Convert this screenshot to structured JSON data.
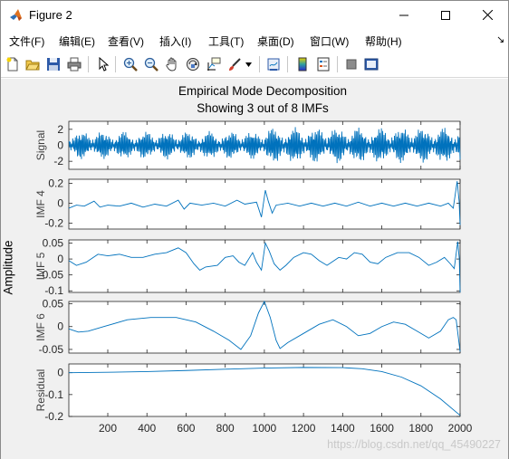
{
  "window": {
    "title": "Figure 2",
    "controls": {
      "minimize": "minimize",
      "maximize": "maximize",
      "close": "close"
    }
  },
  "menubar": {
    "items": [
      "文件(F)",
      "编辑(E)",
      "查看(V)",
      "插入(I)",
      "工具(T)",
      "桌面(D)",
      "窗口(W)",
      "帮助(H)"
    ],
    "corner": "↘"
  },
  "toolbar": {
    "icons": [
      "new-figure-icon",
      "open-file-icon",
      "save-icon",
      "print-icon",
      "pointer-icon",
      "zoom-in-icon",
      "zoom-out-icon",
      "pan-icon",
      "rotate-3d-icon",
      "data-cursor-icon",
      "brush-icon",
      "brush-dropdown-icon",
      "link-plot-icon",
      "insert-colorbar-icon",
      "insert-legend-icon",
      "hide-plot-tools-icon",
      "show-plot-tools-icon"
    ]
  },
  "figure": {
    "title_line1": "Empirical Mode Decomposition",
    "title_line2": "Showing 3 out of 8 IMFs",
    "ylabel": "Amplitude",
    "xticks": [
      "200",
      "400",
      "600",
      "800",
      "1000",
      "1200",
      "1400",
      "1600",
      "1800",
      "2000"
    ],
    "line_color": "#0072bd",
    "watermark": "https://blog.csdn.net/qq_45490227"
  },
  "chart_data": [
    {
      "type": "line",
      "ylabel": "Signal",
      "xlim": [
        1,
        2000
      ],
      "ylim": [
        -3,
        3
      ],
      "yticks": [
        "2",
        "0",
        "-2"
      ],
      "description_points": [
        [
          1,
          0
        ],
        [
          1000,
          0
        ],
        [
          2000,
          0
        ]
      ],
      "amplitude_before_1000": 1.8,
      "amplitude_after_1000": 2.3
    },
    {
      "type": "line",
      "ylabel": "IMF 4",
      "xlim": [
        1,
        2000
      ],
      "ylim": [
        -0.26,
        0.24
      ],
      "yticks": [
        "0.2",
        "0",
        "-0.2"
      ],
      "points": [
        [
          1,
          -0.05
        ],
        [
          40,
          -0.02
        ],
        [
          80,
          -0.03
        ],
        [
          130,
          0.02
        ],
        [
          160,
          -0.04
        ],
        [
          200,
          -0.02
        ],
        [
          260,
          -0.03
        ],
        [
          320,
          0.0
        ],
        [
          380,
          -0.04
        ],
        [
          440,
          -0.01
        ],
        [
          500,
          -0.03
        ],
        [
          560,
          0.03
        ],
        [
          590,
          -0.06
        ],
        [
          620,
          0.0
        ],
        [
          680,
          -0.02
        ],
        [
          740,
          0.0
        ],
        [
          800,
          -0.03
        ],
        [
          860,
          0.03
        ],
        [
          900,
          -0.01
        ],
        [
          960,
          0.01
        ],
        [
          985,
          -0.14
        ],
        [
          1005,
          0.13
        ],
        [
          1020,
          0.02
        ],
        [
          1040,
          -0.1
        ],
        [
          1060,
          -0.02
        ],
        [
          1120,
          0.0
        ],
        [
          1180,
          -0.03
        ],
        [
          1240,
          0.0
        ],
        [
          1300,
          -0.03
        ],
        [
          1360,
          0.0
        ],
        [
          1420,
          -0.03
        ],
        [
          1480,
          0.01
        ],
        [
          1540,
          -0.03
        ],
        [
          1600,
          0.0
        ],
        [
          1660,
          -0.03
        ],
        [
          1720,
          0.0
        ],
        [
          1780,
          -0.03
        ],
        [
          1840,
          0.0
        ],
        [
          1900,
          -0.03
        ],
        [
          1940,
          0.0
        ],
        [
          1965,
          -0.05
        ],
        [
          1985,
          0.22
        ],
        [
          1995,
          0.02
        ],
        [
          2000,
          -0.22
        ]
      ]
    },
    {
      "type": "line",
      "ylabel": "IMF 5",
      "xlim": [
        1,
        2000
      ],
      "ylim": [
        -0.105,
        0.06
      ],
      "yticks": [
        "0.05",
        "0",
        "-0.05",
        "-0.1"
      ],
      "points": [
        [
          1,
          -0.005
        ],
        [
          40,
          -0.02
        ],
        [
          90,
          -0.01
        ],
        [
          150,
          0.015
        ],
        [
          200,
          0.01
        ],
        [
          260,
          0.015
        ],
        [
          320,
          0.005
        ],
        [
          380,
          0.005
        ],
        [
          440,
          0.015
        ],
        [
          500,
          0.02
        ],
        [
          560,
          0.035
        ],
        [
          600,
          0.02
        ],
        [
          640,
          -0.015
        ],
        [
          670,
          -0.035
        ],
        [
          700,
          -0.025
        ],
        [
          760,
          -0.02
        ],
        [
          800,
          0.005
        ],
        [
          840,
          0.01
        ],
        [
          870,
          -0.01
        ],
        [
          900,
          -0.02
        ],
        [
          940,
          0.02
        ],
        [
          960,
          -0.01
        ],
        [
          985,
          -0.035
        ],
        [
          1005,
          0.05
        ],
        [
          1025,
          0.025
        ],
        [
          1050,
          -0.015
        ],
        [
          1080,
          -0.035
        ],
        [
          1110,
          -0.02
        ],
        [
          1150,
          0.005
        ],
        [
          1200,
          0.02
        ],
        [
          1240,
          0.015
        ],
        [
          1280,
          -0.005
        ],
        [
          1320,
          -0.02
        ],
        [
          1380,
          0.005
        ],
        [
          1420,
          0.0
        ],
        [
          1460,
          0.02
        ],
        [
          1500,
          0.015
        ],
        [
          1540,
          -0.01
        ],
        [
          1580,
          -0.015
        ],
        [
          1620,
          0.005
        ],
        [
          1680,
          0.02
        ],
        [
          1740,
          0.02
        ],
        [
          1790,
          0.005
        ],
        [
          1840,
          -0.02
        ],
        [
          1880,
          -0.01
        ],
        [
          1920,
          0.005
        ],
        [
          1950,
          -0.015
        ],
        [
          1970,
          -0.03
        ],
        [
          1988,
          0.055
        ],
        [
          1996,
          0.0
        ],
        [
          2000,
          -0.105
        ]
      ]
    },
    {
      "type": "line",
      "ylabel": "IMF 6",
      "xlim": [
        1,
        2000
      ],
      "ylim": [
        -0.058,
        0.055
      ],
      "yticks": [
        "0.05",
        "0",
        "-0.05"
      ],
      "points": [
        [
          1,
          -0.005
        ],
        [
          50,
          -0.012
        ],
        [
          100,
          -0.01
        ],
        [
          180,
          0.0
        ],
        [
          300,
          0.015
        ],
        [
          420,
          0.02
        ],
        [
          550,
          0.02
        ],
        [
          650,
          0.01
        ],
        [
          740,
          -0.01
        ],
        [
          820,
          -0.03
        ],
        [
          880,
          -0.05
        ],
        [
          930,
          -0.02
        ],
        [
          970,
          0.03
        ],
        [
          1000,
          0.055
        ],
        [
          1030,
          0.02
        ],
        [
          1060,
          -0.03
        ],
        [
          1080,
          -0.048
        ],
        [
          1120,
          -0.035
        ],
        [
          1200,
          -0.015
        ],
        [
          1280,
          0.005
        ],
        [
          1350,
          0.015
        ],
        [
          1420,
          0.0
        ],
        [
          1480,
          -0.02
        ],
        [
          1540,
          -0.015
        ],
        [
          1600,
          0.0
        ],
        [
          1660,
          0.01
        ],
        [
          1720,
          0.005
        ],
        [
          1780,
          -0.01
        ],
        [
          1840,
          -0.025
        ],
        [
          1900,
          -0.01
        ],
        [
          1940,
          0.015
        ],
        [
          1965,
          0.02
        ],
        [
          1980,
          0.015
        ],
        [
          1990,
          -0.02
        ],
        [
          2000,
          -0.055
        ]
      ]
    },
    {
      "type": "line",
      "ylabel": "Residual",
      "xlim": [
        1,
        2000
      ],
      "ylim": [
        -0.2,
        0.04
      ],
      "yticks": [
        "0",
        "-0.1",
        "-0.2"
      ],
      "points": [
        [
          1,
          0.0
        ],
        [
          200,
          0.002
        ],
        [
          400,
          0.005
        ],
        [
          600,
          0.01
        ],
        [
          800,
          0.016
        ],
        [
          1000,
          0.021
        ],
        [
          1200,
          0.024
        ],
        [
          1400,
          0.023
        ],
        [
          1500,
          0.018
        ],
        [
          1600,
          0.005
        ],
        [
          1700,
          -0.02
        ],
        [
          1800,
          -0.06
        ],
        [
          1900,
          -0.12
        ],
        [
          2000,
          -0.195
        ]
      ]
    }
  ]
}
